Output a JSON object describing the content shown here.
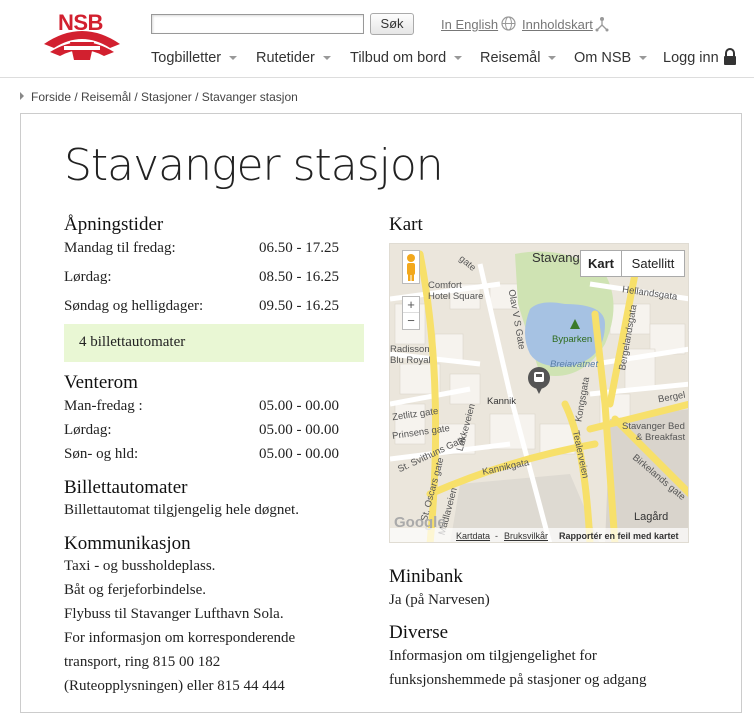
{
  "header": {
    "logo_text": "NSB",
    "search_placeholder": "",
    "search_button": "Søk",
    "lang_link": "In English",
    "sitemap_link": "Innholdskart",
    "nav": [
      "Togbilletter",
      "Rutetider",
      "Tilbud om bord",
      "Reisemål",
      "Om NSB"
    ],
    "login": "Logg inn"
  },
  "breadcrumb": "Forside / Reisemål / Stasjoner / Stavanger stasjon",
  "page_title": "Stavanger stasjon",
  "opening": {
    "heading": "Åpningstider",
    "rows": [
      {
        "label": "Mandag til fredag:",
        "value": "06.50 - 17.25"
      },
      {
        "label": "Lørdag:",
        "value": "08.50 - 16.25"
      },
      {
        "label": "Søndag og helligdager:",
        "value": "09.50 - 16.25"
      }
    ],
    "highlight": "4 billettautomater"
  },
  "waiting_room": {
    "heading": "Venterom",
    "rows": [
      {
        "label": "Man-fredag :",
        "value": "05.00 - 00.00"
      },
      {
        "label": "Lørdag:",
        "value": "05.00 - 00.00"
      },
      {
        "label": "Søn- og hld:",
        "value": "05.00 - 00.00"
      }
    ]
  },
  "ticket_machines": {
    "heading": "Billettautomater",
    "text": "Billettautomat tilgjengelig hele døgnet."
  },
  "communication": {
    "heading": "Kommunikasjon",
    "lines": [
      "Taxi - og bussholdeplass.",
      "Båt og ferjeforbindelse.",
      "Flybuss til Stavanger Lufthavn Sola.",
      "For informasjon om korresponderende",
      "transport, ring 815 00 182",
      "(Ruteopplysningen) eller 815 44 444"
    ]
  },
  "map": {
    "heading": "Kart",
    "btn_map": "Kart",
    "btn_satellite": "Satellitt",
    "zoom_in": "+",
    "zoom_out": "−",
    "labels": {
      "stavang": "Stavang",
      "comfort1": "Comfort",
      "comfort2": "Hotel Square",
      "radisson1": "Radisson",
      "radisson2": "Blu Royal",
      "byparken": "Byparken",
      "breiavatnet": "Breiavatnet",
      "kannik": "Kannik",
      "helland": "Hellandsgata",
      "bergeland": "Bergelandsgata",
      "berge": "Bergel",
      "olav": "Olav V S Gate",
      "zetlitz": "Zetlitz gate",
      "prinsens": "Prinsens gate",
      "lokkeveien": "Løkkeveien",
      "svithuns": "St. Svithuns Gate",
      "oscars": "St. Oscars gate",
      "kannikgata": "Kannikgata",
      "kongsgata": "Kongsgata",
      "tealerveien": "Tealerveien",
      "stavbed1": "Stavanger Bed",
      "stavbed2": "& Breakfast",
      "birkelands": "Birkelands gate",
      "lagard": "Lagård",
      "madlaveien": "Madlaveien",
      "gate": "gate",
      "google": "Google"
    },
    "footer_data": "Kartdata",
    "footer_terms": "Bruksvilkår",
    "footer_report": "Rapportér en feil med kartet"
  },
  "minibank": {
    "heading": "Minibank",
    "text": "Ja (på Narvesen)"
  },
  "diverse": {
    "heading": "Diverse",
    "lines": [
      "Informasjon om tilgjengelighet for",
      "funksjonshemmede på stasjoner og adgang"
    ]
  }
}
